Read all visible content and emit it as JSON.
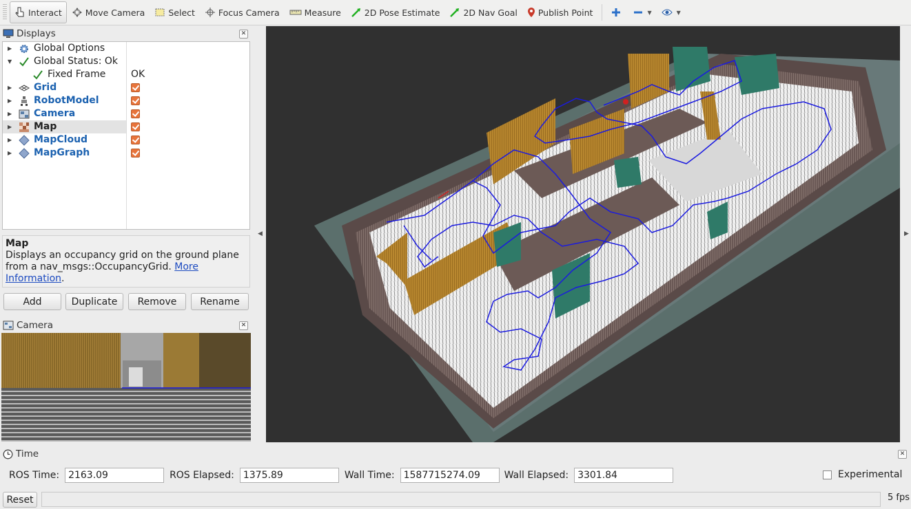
{
  "toolbar": {
    "tools": [
      {
        "label": "Interact",
        "icon": "hand-pointer-icon",
        "active": true
      },
      {
        "label": "Move Camera",
        "icon": "move-camera-icon"
      },
      {
        "label": "Select",
        "icon": "select-box-icon"
      },
      {
        "label": "Focus Camera",
        "icon": "focus-crosshair-icon"
      },
      {
        "label": "Measure",
        "icon": "ruler-icon"
      },
      {
        "label": "2D Pose Estimate",
        "icon": "green-arrow-icon"
      },
      {
        "label": "2D Nav Goal",
        "icon": "green-arrow-icon"
      },
      {
        "label": "Publish Point",
        "icon": "map-pin-icon"
      }
    ]
  },
  "displays": {
    "title": "Displays",
    "rows": [
      {
        "label": "Global Options",
        "icon": "gear-icon",
        "expander": "collapsed",
        "style": "normal"
      },
      {
        "label": "Global Status: Ok",
        "icon": "checkmark-icon",
        "expander": "expanded",
        "style": "normal"
      },
      {
        "label": "Fixed Frame",
        "icon": "checkmark-icon",
        "expander": "none",
        "value": "OK",
        "indent": true
      },
      {
        "label": "Grid",
        "icon": "grid-icon",
        "expander": "collapsed",
        "style": "blue",
        "checked": true
      },
      {
        "label": "RobotModel",
        "icon": "robot-icon",
        "expander": "collapsed",
        "style": "blue",
        "checked": true
      },
      {
        "label": "Camera",
        "icon": "camera-icon",
        "expander": "collapsed",
        "style": "blue",
        "checked": true
      },
      {
        "label": "Map",
        "icon": "map-grid-icon",
        "expander": "collapsed",
        "style": "bold",
        "checked": true,
        "selected": true
      },
      {
        "label": "MapCloud",
        "icon": "diamond-icon",
        "expander": "collapsed",
        "style": "blue",
        "checked": true
      },
      {
        "label": "MapGraph",
        "icon": "diamond-icon",
        "expander": "collapsed",
        "style": "blue",
        "checked": true
      }
    ],
    "description": {
      "title": "Map",
      "text": "Displays an occupancy grid on the ground plane from a nav_msgs::OccupancyGrid. ",
      "link1": "More",
      "link2": "Information",
      "tail": "."
    },
    "buttons": {
      "add": "Add",
      "duplicate": "Duplicate",
      "remove": "Remove",
      "rename": "Rename"
    }
  },
  "camera_panel": {
    "title": "Camera"
  },
  "time": {
    "title": "Time",
    "ros_time_label": "ROS Time:",
    "ros_time": "2163.09",
    "ros_elapsed_label": "ROS Elapsed:",
    "ros_elapsed": "1375.89",
    "wall_time_label": "Wall Time:",
    "wall_time": "1587715274.09",
    "wall_elapsed_label": "Wall Elapsed:",
    "wall_elapsed": "3301.84",
    "experimental_label": "Experimental",
    "experimental_checked": false
  },
  "status": {
    "reset_label": "Reset",
    "fps": "5 fps"
  },
  "colors": {
    "accent_check": "#e8743b",
    "path": "#1a1ae0",
    "wall_orange": "#b8872f",
    "wall_teal": "#2f7a68"
  }
}
